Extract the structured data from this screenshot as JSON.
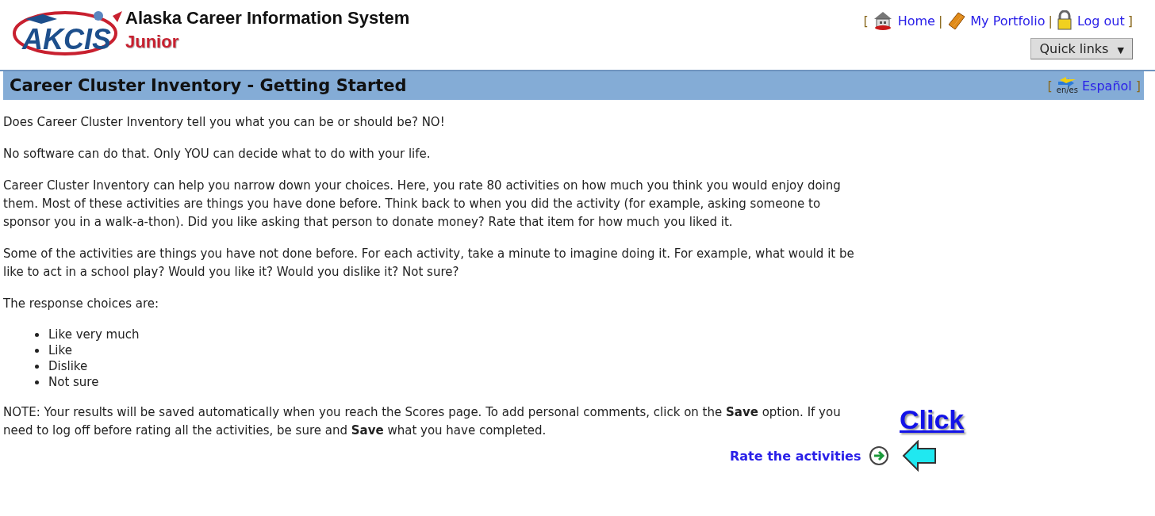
{
  "logo": {
    "mark": "AKCIS",
    "title": "Alaska Career Information System",
    "subtitle": "Junior"
  },
  "top_links": [
    {
      "kind": "bracket",
      "text": "["
    },
    {
      "kind": "link",
      "text": "Home"
    },
    {
      "kind": "separator",
      "text": "|"
    },
    {
      "kind": "link",
      "text": "My Portfolio"
    },
    {
      "kind": "separator",
      "text": "|"
    },
    {
      "kind": "link",
      "text": "Log out"
    },
    {
      "kind": "bracket",
      "text": "]"
    }
  ],
  "quick_links": {
    "label": "Quick links",
    "caret": "▼"
  },
  "title_bar": {
    "title": "Career Cluster Inventory - Getting Started",
    "language": {
      "open": "[",
      "badge": "en/es",
      "label": "Español",
      "close": "]"
    }
  },
  "paragraphs": [
    "Does Career Cluster Inventory tell you what you can be or should be? NO!",
    "No software can do that. Only YOU can decide what to do with your life.",
    "Career Cluster Inventory can help you narrow down your choices. Here, you rate 80 activities on how much you think you would enjoy doing them. Most of these activities are things you have done before. Think back to when you did the activity (for example, asking someone to sponsor you in a walk-a-thon). Did you like asking that person to donate money? Rate that item for how much you liked it.",
    "Some of the activities are things you have not done before. For each activity, take a minute to imagine doing it. For example, what would it be like to act in a school play? Would you like it? Would you dislike it? Not sure?",
    "The response choices are:"
  ],
  "choices": [
    "Like very much",
    "Like",
    "Dislike",
    "Not sure"
  ],
  "note": "NOTE: Your results will be saved automatically when you reach the Scores page. To add personal comments, click on the **Save** option. If you need to log off before rating all the activities, be sure and **Save** what you have completed.",
  "callout": "Click",
  "next_link": "Rate the activities"
}
